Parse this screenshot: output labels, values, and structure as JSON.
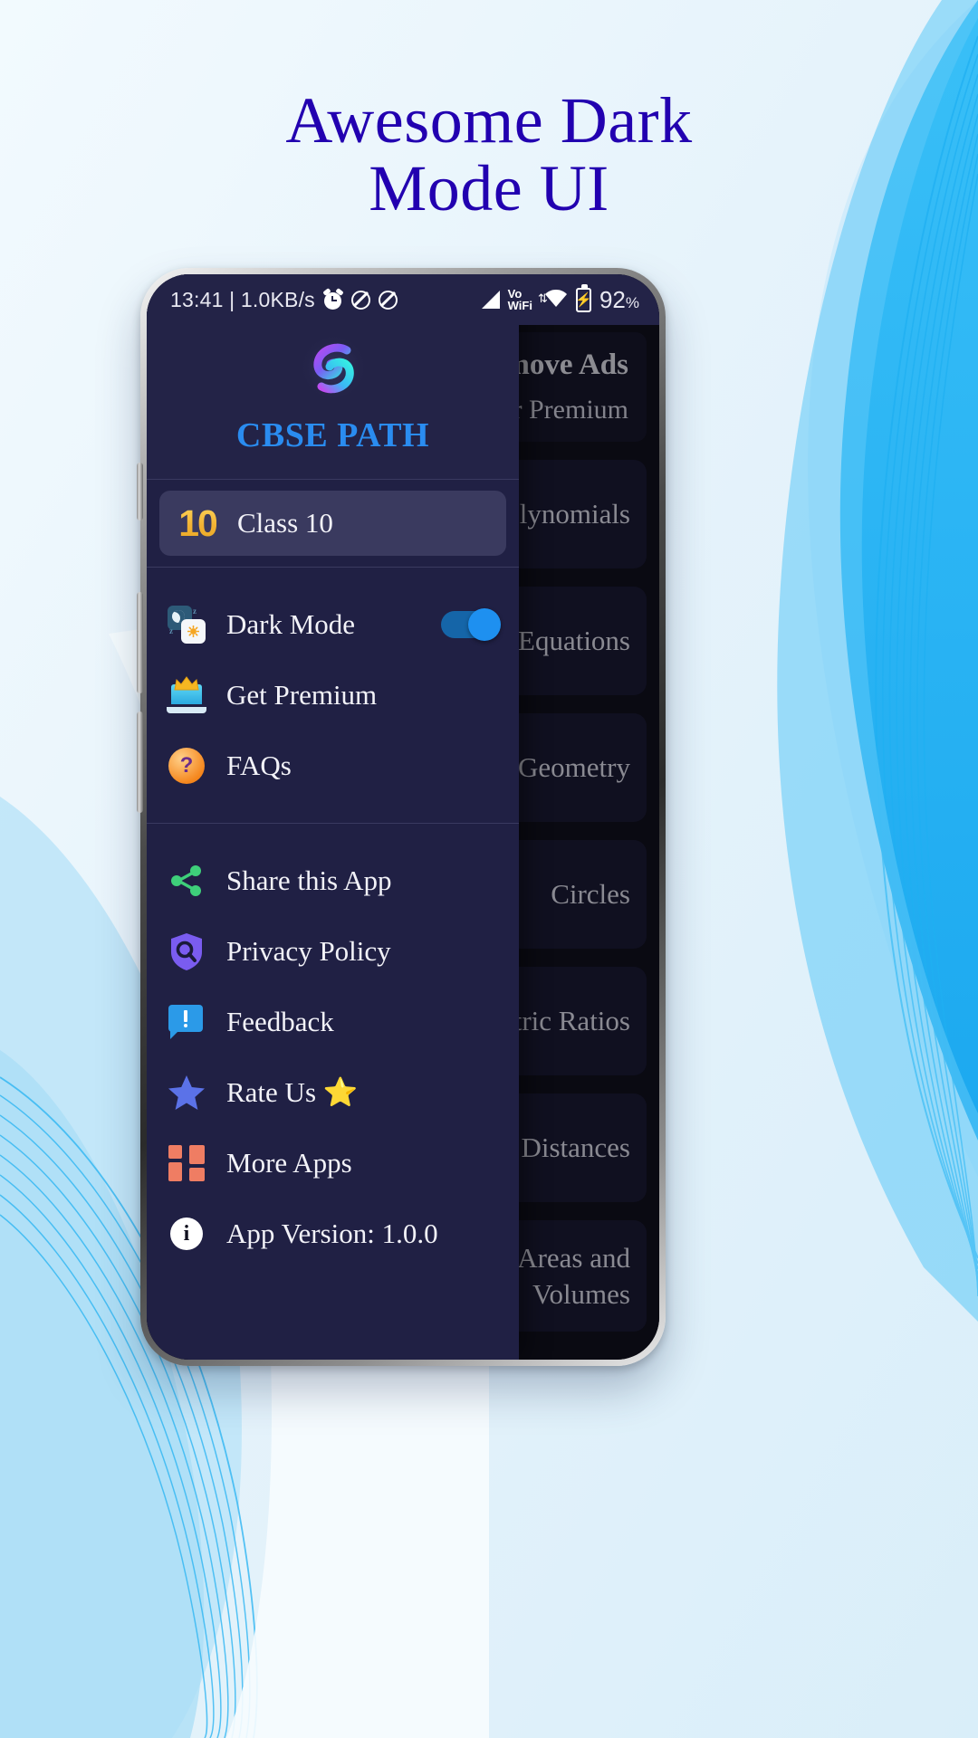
{
  "headline": {
    "line1": "Awesome Dark",
    "line2": "Mode UI"
  },
  "statusbar": {
    "left_text": "13:41 | 1.0KB/s",
    "alarm_icon": "alarm-clock-icon",
    "mute_icon_1": "ringer-off-icon",
    "mute_icon_2": "vibrate-off-icon",
    "signal_icon": "cellular-signal-icon",
    "volte_label": "Vo",
    "wifi_label": "WiFi",
    "wifi_icon": "wifi-icon",
    "battery_icon": "battery-charging-icon",
    "battery_percent": "92",
    "battery_percent_symbol": "%"
  },
  "drawer": {
    "app_name": "CBSE PATH",
    "logo_icon": "cbse-path-logo",
    "selected": {
      "badge": "10",
      "label": "Class 10",
      "icon": "class-10-badge-icon"
    },
    "group_settings": [
      {
        "label": "Dark Mode",
        "icon": "dark-mode-icon",
        "toggle": true,
        "toggle_on": true
      },
      {
        "label": "Get Premium",
        "icon": "crown-laptop-icon",
        "toggle": false
      },
      {
        "label": "FAQs",
        "icon": "question-mark-icon",
        "toggle": false
      }
    ],
    "group_actions": [
      {
        "label": "Share this App",
        "icon": "share-icon"
      },
      {
        "label": "Privacy Policy",
        "icon": "shield-icon"
      },
      {
        "label": "Feedback",
        "icon": "feedback-icon"
      },
      {
        "label": "Rate Us ⭐",
        "icon": "star-icon"
      },
      {
        "label": "More Apps",
        "icon": "grid-apps-icon"
      },
      {
        "label": "App Version: 1.0.0",
        "icon": "info-icon"
      }
    ]
  },
  "content": {
    "ad_card": {
      "title": "Remove Ads",
      "subtitle": "Our Premium"
    },
    "topics": [
      "Polynomials",
      "Quadratic Equations",
      "Co-ordinate Geometry",
      "Circles",
      "Trigonometric Ratios",
      "Heights and Distances",
      "Surface Areas and Volumes"
    ]
  },
  "colors": {
    "headline": "#2200b0",
    "drawer_bg": "#202044",
    "drawer_head_bg": "#232347",
    "selected_row": "#3a3a5f",
    "app_name": "#2a8cf0",
    "toggle_on": "#1e90f0",
    "badge_gold": "#f2b233",
    "page_bg": "#eaf4fb",
    "wave_blue": "#29b6f6"
  }
}
